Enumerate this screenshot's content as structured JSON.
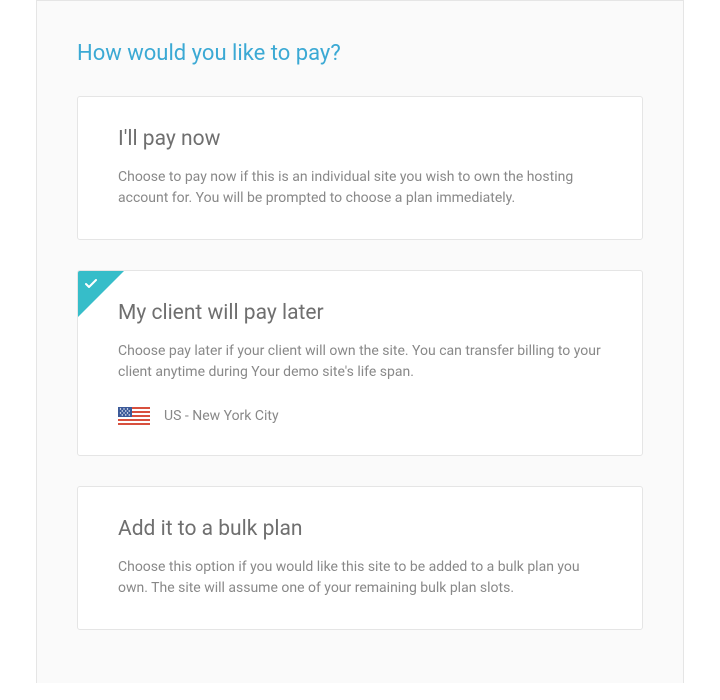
{
  "heading": "How would you like to pay?",
  "options": [
    {
      "title": "I'll pay now",
      "description": "Choose to pay now if this is an individual site you wish to own the hosting account for. You will be prompted to choose a plan immediately.",
      "selected": false
    },
    {
      "title": "My client will pay later",
      "description": "Choose pay later if your client will own the site. You can transfer billing to your client anytime during Your demo site's life span.",
      "selected": true,
      "location": "US - New York City"
    },
    {
      "title": "Add it to a bulk plan",
      "description": "Choose this option if you would like this site to be added to a bulk plan you own. The site will assume one of your remaining bulk plan slots.",
      "selected": false
    }
  ]
}
